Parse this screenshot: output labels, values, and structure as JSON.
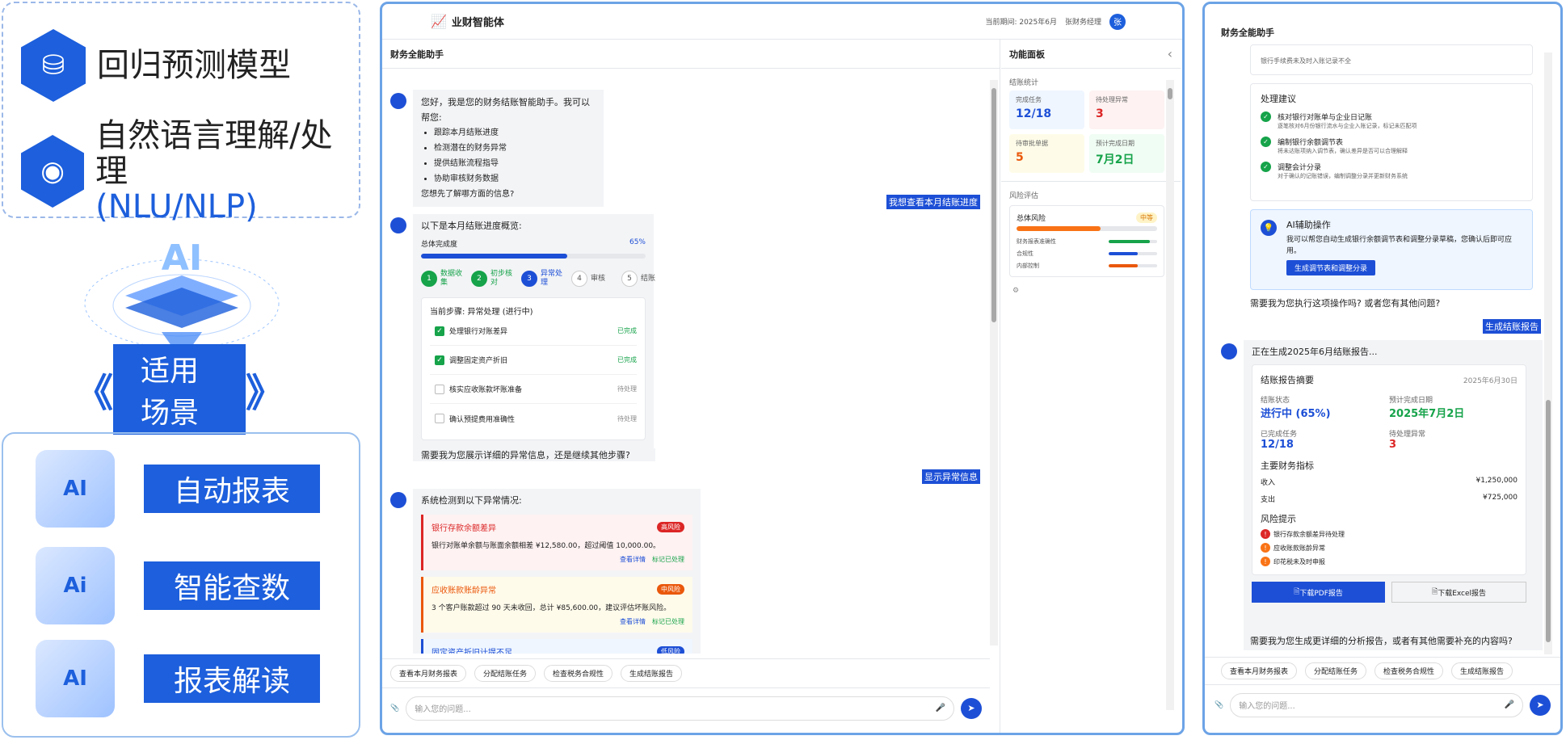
{
  "left": {
    "models": [
      {
        "label": "回归预测模型",
        "icon": "database-icon"
      },
      {
        "label": "自然语言理解/处理",
        "sub": "(NLU/NLP)",
        "icon": "ai-brain-icon"
      }
    ],
    "ai_text": "AI",
    "scenario": "适用场景",
    "features": [
      {
        "label": "自动报表",
        "icon_text": "AI"
      },
      {
        "label": "智能查数",
        "icon_text": "Ai"
      },
      {
        "label": "报表解读",
        "icon_text": "AI"
      }
    ]
  },
  "app": {
    "title": "业财智能体",
    "period": "当前期间: 2025年6月",
    "user": "张财务经理",
    "avatar": "张",
    "chat_title": "财务全能助手",
    "panel_title": "功能面板",
    "m1": {
      "text": "您好，我是您的财务结账智能助手。我可以帮您:",
      "items": [
        "跟踪本月结账进度",
        "检测潜在的财务异常",
        "提供结账流程指导",
        "协助审核财务数据"
      ],
      "end": "您想先了解哪方面的信息?"
    },
    "u1": "我想查看本月结账进度",
    "m2": {
      "text": "以下是本月结账进度概览:",
      "progress_label": "总体完成度",
      "progress": "65%",
      "progress_value": 0.65,
      "steps": [
        {
          "n": "1",
          "label": "数据收集",
          "state": "done"
        },
        {
          "n": "2",
          "label": "初步核对",
          "state": "done"
        },
        {
          "n": "3",
          "label": "异常处理",
          "state": "active"
        },
        {
          "n": "4",
          "label": "审核",
          "state": "todo"
        },
        {
          "n": "5",
          "label": "结账",
          "state": "todo"
        }
      ],
      "current": "当前步骤: 异常处理 (进行中)",
      "tasks": [
        {
          "label": "处理银行对账差异",
          "status": "已完成",
          "done": true
        },
        {
          "label": "调整固定资产折旧",
          "status": "已完成",
          "done": true
        },
        {
          "label": "核实应收账款坏账准备",
          "status": "待处理",
          "done": false
        },
        {
          "label": "确认预提费用准确性",
          "status": "待处理",
          "done": false
        }
      ],
      "end": "需要我为您展示详细的异常信息，还是继续其他步骤?"
    },
    "u2": "显示异常信息",
    "m3": {
      "text": "系统检测到以下异常情况:",
      "anomalies": [
        {
          "title": "银行存款余额差异",
          "tag": "高风险",
          "desc": "银行对账单余额与账面余额相差 ¥12,580.00，超过阈值 10,000.00。",
          "a1": "查看详情",
          "a2": "标记已处理",
          "color": "#dc2626",
          "bg": "#fef2f2"
        },
        {
          "title": "应收账款账龄异常",
          "tag": "中风险",
          "desc": "3 个客户账款超过 90 天未收回，总计 ¥85,600.00，建议评估坏账风险。",
          "a1": "查看详情",
          "a2": "标记已处理",
          "color": "#ea580c",
          "bg": "#fffbeb"
        },
        {
          "title": "固定资产折旧计提不足",
          "tag": "低风险",
          "color": "#1d4fd6",
          "bg": "#eff6ff"
        }
      ]
    },
    "quick": [
      "查看本月财务报表",
      "分配结账任务",
      "检查税务合规性",
      "生成结账报告"
    ],
    "input_placeholder": "输入您的问题...",
    "stats_title": "结账统计",
    "stats": [
      {
        "label": "完成任务",
        "value": "12/18",
        "color": "#1d4fd6",
        "bg": "#eff6ff"
      },
      {
        "label": "待处理异常",
        "value": "3",
        "color": "#dc2626",
        "bg": "#fef2f2"
      },
      {
        "label": "待审批单据",
        "value": "5",
        "color": "#ea580c",
        "bg": "#fefce8"
      },
      {
        "label": "预计完成日期",
        "value": "7月2日",
        "color": "#16a34a",
        "bg": "#f0fdf4"
      }
    ],
    "risk_title": "风险评估",
    "risk_total": "总体风险",
    "risk_level": "中等",
    "risk_value": 0.6,
    "risks": [
      {
        "label": "财务报表准确性",
        "value": 0.85,
        "color": "#16a34a"
      },
      {
        "label": "合规性",
        "value": 0.6,
        "color": "#1d4fd6"
      },
      {
        "label": "内部控制",
        "value": 0.6,
        "color": "#ea580c"
      }
    ]
  },
  "right": {
    "title": "财务全能助手",
    "top_item": "银行手续费未及时入账记录不全",
    "suggest_title": "处理建议",
    "suggestions": [
      {
        "t": "核对银行对账单与企业日记账",
        "d": "逐笔核对6月份银行流水与企业入账记录，标记未匹配项"
      },
      {
        "t": "编制银行余额调节表",
        "d": "将未达账项纳入调节表，确认差异是否可以合理解释"
      },
      {
        "t": "调整会计分录",
        "d": "对于确认的记账错误，编制调整分录并更新财务系统"
      }
    ],
    "ai_title": "AI辅助操作",
    "ai_desc": "我可以帮您自动生成银行余额调节表和调整分录草稿，您确认后即可应用。",
    "ai_btn": "生成调节表和调整分录",
    "q1": "需要我为您执行这项操作吗? 或者您有其他问题?",
    "u": "生成结账报告",
    "gen": "正在生成2025年6月结账报告...",
    "summary": "结账报告摘要",
    "date": "2025年6月30日",
    "f1l": "结账状态",
    "f1v": "进行中 (65%)",
    "f2l": "预计完成日期",
    "f2v": "2025年7月2日",
    "f3l": "已完成任务",
    "f3v": "12/18",
    "f4l": "待处理异常",
    "f4v": "3",
    "kpi": "主要财务指标",
    "rev_l": "收入",
    "rev_v": "¥1,250,000",
    "exp_l": "支出",
    "exp_v": "¥725,000",
    "risk": "风险提示",
    "risks": [
      "银行存款余额差异待处理",
      "应收账款账龄异常",
      "印花税未及时申报"
    ],
    "pdf": "下载PDF报告",
    "excel": "下载Excel报告",
    "q2": "需要我为您生成更详细的分析报告，或者有其他需要补充的内容吗?",
    "quick": [
      "查看本月财务报表",
      "分配结账任务",
      "检查税务合规性",
      "生成结账报告"
    ],
    "input_placeholder": "输入您的问题..."
  }
}
